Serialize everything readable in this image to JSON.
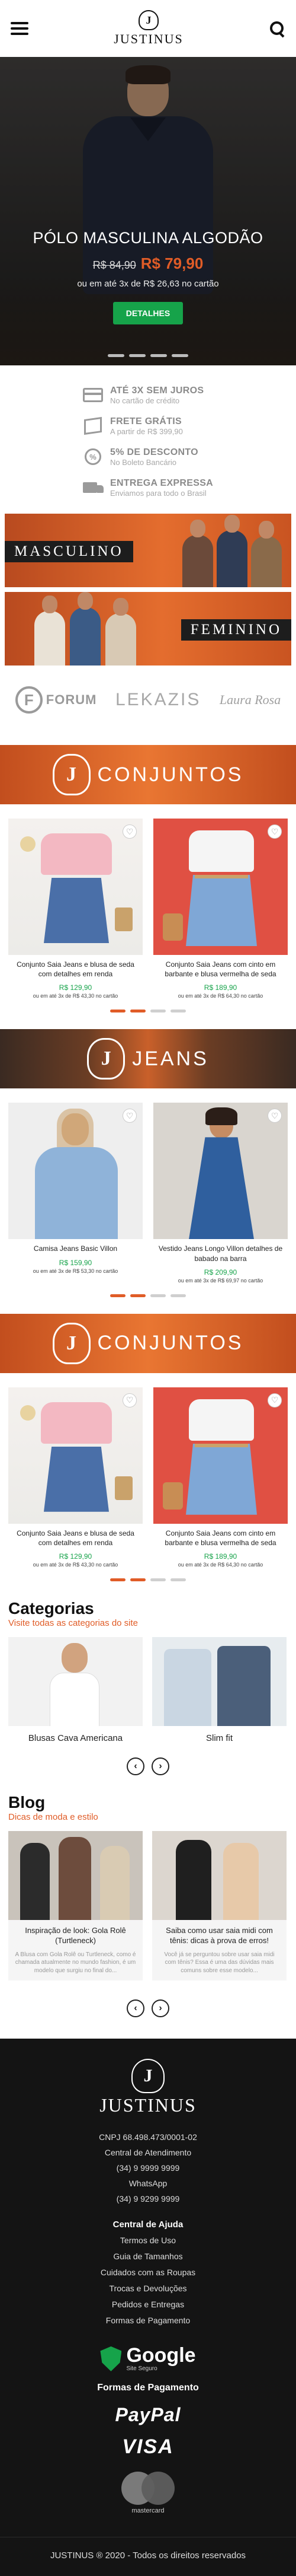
{
  "header": {
    "menu_icon": "hamburger-menu-icon",
    "logo_monogram": "J",
    "logo_text": "JUSTINUS",
    "search_icon": "search-icon"
  },
  "hero": {
    "title": "PÓLO MASCULINA ALGODÃO",
    "price_old": "R$ 84,90",
    "price_new": "R$ 79,90",
    "installments": "ou em até 3x de R$ 26,63 no cartão",
    "button": "DETALHES",
    "active_slide": 0,
    "slides": 4
  },
  "benefits": [
    {
      "icon": "credit-card-icon",
      "title": "ATÉ 3X SEM JUROS",
      "subtitle": "No cartão de crédito"
    },
    {
      "icon": "box-icon",
      "title": "FRETE GRÁTIS",
      "subtitle": "A partir de R$ 399,90"
    },
    {
      "icon": "percent-icon",
      "title": "5% DE DESCONTO",
      "subtitle": "No Boleto Bancário"
    },
    {
      "icon": "truck-icon",
      "title": "ENTREGA EXPRESSA",
      "subtitle": "Enviamos para todo o Brasil"
    }
  ],
  "category_banners": [
    {
      "label": "MASCULINO"
    },
    {
      "label": "FEMININO"
    }
  ],
  "brands": {
    "forum_mark": "F",
    "forum_name": "FORUM",
    "lekazis": "LEKAZIS",
    "laura": "Laura Rosa"
  },
  "sections": [
    {
      "title": "CONJUNTOS",
      "monogram": "J",
      "products": [
        {
          "name": "Conjunto Saia Jeans e blusa de seda com detalhes em renda",
          "price": "R$ 129,90",
          "installments": "ou em até 3x de R$ 43,30 no cartão"
        },
        {
          "name": "Conjunto Saia Jeans com cinto em barbante e blusa vermelha de seda",
          "price": "R$ 189,90",
          "installments": "ou em até 3x de R$ 64,30 no cartão"
        }
      ]
    },
    {
      "title": "JEANS",
      "monogram": "J",
      "products": [
        {
          "name": "Camisa Jeans Basic Villon",
          "price": "R$ 159,90",
          "installments": "ou em até 3x de R$ 53,30 no cartão"
        },
        {
          "name": "Vestido Jeans Longo Villon detalhes de babado na barra",
          "price": "R$ 209,90",
          "installments": "ou em até 3x de R$ 69,97 no cartão"
        }
      ]
    },
    {
      "title": "CONJUNTOS",
      "monogram": "J",
      "products": [
        {
          "name": "Conjunto Saia Jeans e blusa de seda com detalhes em renda",
          "price": "R$ 129,90",
          "installments": "ou em até 3x de R$ 43,30 no cartão"
        },
        {
          "name": "Conjunto Saia Jeans com cinto em barbante e blusa vermelha de seda",
          "price": "R$ 189,90",
          "installments": "ou em até 3x de R$ 64,30 no cartão"
        }
      ]
    }
  ],
  "categories": {
    "title": "Categorias",
    "link": "Visite todas as categorias do site",
    "items": [
      {
        "label": "Blusas Cava Americana"
      },
      {
        "label": "Slim fit"
      }
    ],
    "prev": "‹",
    "next": "›"
  },
  "blog": {
    "title": "Blog",
    "subtitle": "Dicas de moda e estilo",
    "posts": [
      {
        "title": "Inspiração de look: Gola Rolê (Turtleneck)",
        "excerpt": "A Blusa com Gola Rolê ou Turtleneck, como é chamada atualmente no mundo fashion, é um modelo que surgiu no final do..."
      },
      {
        "title": "Saiba como usar saia midi com tênis: dicas à prova de erros!",
        "excerpt": "Você já se perguntou sobre usar saia midi com tênis? Essa é uma das dúvidas mais comuns sobre esse modelo..."
      }
    ],
    "prev": "‹",
    "next": "›"
  },
  "footer": {
    "logo_monogram": "J",
    "logo_text": "JUSTINUS",
    "cnpj": "CNPJ 68.498.473/0001-02",
    "service_label": "Central de Atendimento",
    "phone1": "(34) 9 9999 9999",
    "whatsapp_label": "WhatsApp",
    "phone2": "(34) 9 9299 9999",
    "help_title": "Central de Ajuda",
    "help_links": [
      "Termos de Uso",
      "Guia de Tamanhos",
      "Cuidados com as Roupas",
      "Trocas e Devoluções",
      "Pedidos e Entregas",
      "Formas de Pagamento"
    ],
    "google_name": "Google",
    "google_sub": "Site Seguro",
    "payment_title": "Formas de Pagamento",
    "paypal": "PayPal",
    "visa": "VISA",
    "mastercard": "mastercard",
    "copyright": "JUSTINUS ® 2020 - Todos os direitos reservados"
  },
  "colors": {
    "accent": "#e05c27",
    "price_green": "#16a34a",
    "footer_bg": "#141414"
  }
}
